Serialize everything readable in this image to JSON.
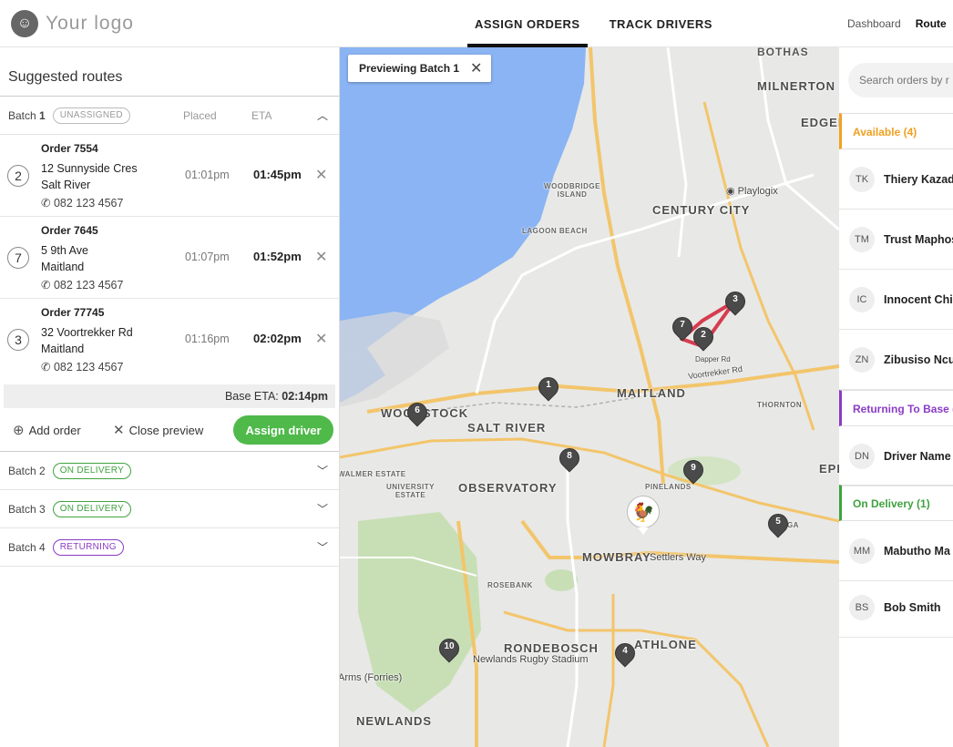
{
  "header": {
    "logo_text": "Your logo",
    "tabs": [
      {
        "label": "ASSIGN ORDERS",
        "active": true
      },
      {
        "label": "TRACK DRIVERS",
        "active": false
      }
    ],
    "links": [
      "Dashboard",
      "Route"
    ]
  },
  "left": {
    "title": "Suggested routes",
    "placed_header": "Placed",
    "eta_header": "ETA",
    "batch1": {
      "label": "Batch",
      "number": "1",
      "status": "UNASSIGNED",
      "orders": [
        {
          "seq": "2",
          "id": "Order 7554",
          "addr1": "12 Sunnyside Cres",
          "addr2": "Salt River",
          "phone": "082 123 4567",
          "placed": "01:01pm",
          "eta": "01:45pm"
        },
        {
          "seq": "7",
          "id": "Order 7645",
          "addr1": "5 9th Ave",
          "addr2": "Maitland",
          "phone": "082 123 4567",
          "placed": "01:07pm",
          "eta": "01:52pm"
        },
        {
          "seq": "3",
          "id": "Order 77745",
          "addr1": "32 Voortrekker Rd",
          "addr2": "Maitland",
          "phone": "082 123 4567",
          "placed": "01:16pm",
          "eta": "02:02pm"
        }
      ],
      "base_eta_label": "Base ETA:",
      "base_eta": "02:14pm",
      "add_order": "Add order",
      "close_preview": "Close preview",
      "assign_driver": "Assign driver"
    },
    "other_batches": [
      {
        "label": "Batch 2",
        "status": "ON DELIVERY",
        "kind": "green"
      },
      {
        "label": "Batch 3",
        "status": "ON DELIVERY",
        "kind": "green"
      },
      {
        "label": "Batch 4",
        "status": "RETURNING",
        "kind": "purple"
      }
    ]
  },
  "map": {
    "preview_label": "Previewing Batch 1",
    "places": {
      "milnerton": "MILNERTON",
      "edge": "EDGEM",
      "buthas": "BOTHAS",
      "woodbridge": "WOODBRIDGE ISLAND",
      "century_city": "CENTURY CITY",
      "playlogix": "Playlogix",
      "lagoon": "LAGOON BEACH",
      "maitland": "MAITLAND",
      "thornton": "THORNTON",
      "woodstock": "WOODSTOCK",
      "salt_river": "SALT RIVER",
      "observatory": "OBSERVATORY",
      "university": "UNIVERSITY ESTATE",
      "walmer": "WALMER ESTATE",
      "pinelands": "PINELANDS",
      "mowbray": "MOWBRAY",
      "settlers": "Settlers Way",
      "rosebank": "ROSEBANK",
      "rondebosch": "RONDEBOSCH",
      "newlands_rugby": "Newlands Rugby Stadium",
      "athlone": "ATHLONE",
      "newlands": "NEWLANDS",
      "arms": "Arms (Forries)",
      "voortrekker": "Voortrekker Rd",
      "dapper": "Dapper Rd",
      "epp": "EPP",
      "langa": "LANGA"
    },
    "pins": [
      "1",
      "2",
      "3",
      "4",
      "5",
      "6",
      "7",
      "8",
      "9",
      "10"
    ],
    "base_marker_icon": "rooster-icon"
  },
  "right": {
    "search_placeholder": "Search orders by r",
    "available": {
      "label": "Available (4)",
      "drivers": [
        {
          "initials": "TK",
          "name": "Thiery Kazadi"
        },
        {
          "initials": "TM",
          "name": "Trust Maphosa"
        },
        {
          "initials": "IC",
          "name": "Innocent Chi"
        },
        {
          "initials": "ZN",
          "name": "Zibusiso Ncube"
        }
      ]
    },
    "returning": {
      "label": "Returning To Base (",
      "drivers": [
        {
          "initials": "DN",
          "name": "Driver Name"
        }
      ]
    },
    "on_delivery": {
      "label": "On Delivery (1)",
      "drivers": [
        {
          "initials": "MM",
          "name": "Mabutho Ma"
        },
        {
          "initials": "BS",
          "name": "Bob Smith"
        }
      ]
    }
  },
  "colors": {
    "accent_green": "#4fb94a",
    "available_orange": "#f0a020",
    "returning_purple": "#8a3bc6",
    "route_red": "#d63b4e"
  }
}
